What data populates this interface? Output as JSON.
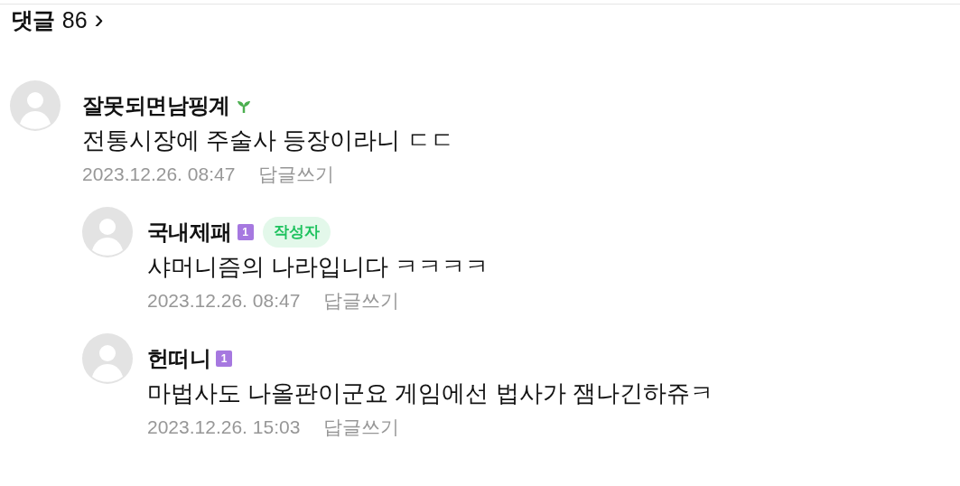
{
  "header": {
    "title": "댓글",
    "count": "86",
    "chevron": "›"
  },
  "comments": [
    {
      "author": "잘못되면남핑계",
      "badge": {
        "kind": "sprout"
      },
      "text": "전통시장에 주술사 등장이라니 ㄷㄷ",
      "date": "2023.12.26. 08:47",
      "reply": "답글쓰기",
      "children": [
        {
          "author": "국내제패",
          "badge": {
            "kind": "level",
            "text": "1"
          },
          "writer_tag": "작성자",
          "text": "샤머니즘의 나라입니다 ㅋㅋㅋㅋ",
          "date": "2023.12.26. 08:47",
          "reply": "답글쓰기"
        },
        {
          "author": "헌떠니",
          "badge": {
            "kind": "level",
            "text": "1"
          },
          "text": "마법사도 나올판이군요 게임에선 법사가 잼나긴하쥬ㅋ",
          "date": "2023.12.26. 15:03",
          "reply": "답글쓰기"
        }
      ]
    }
  ]
}
